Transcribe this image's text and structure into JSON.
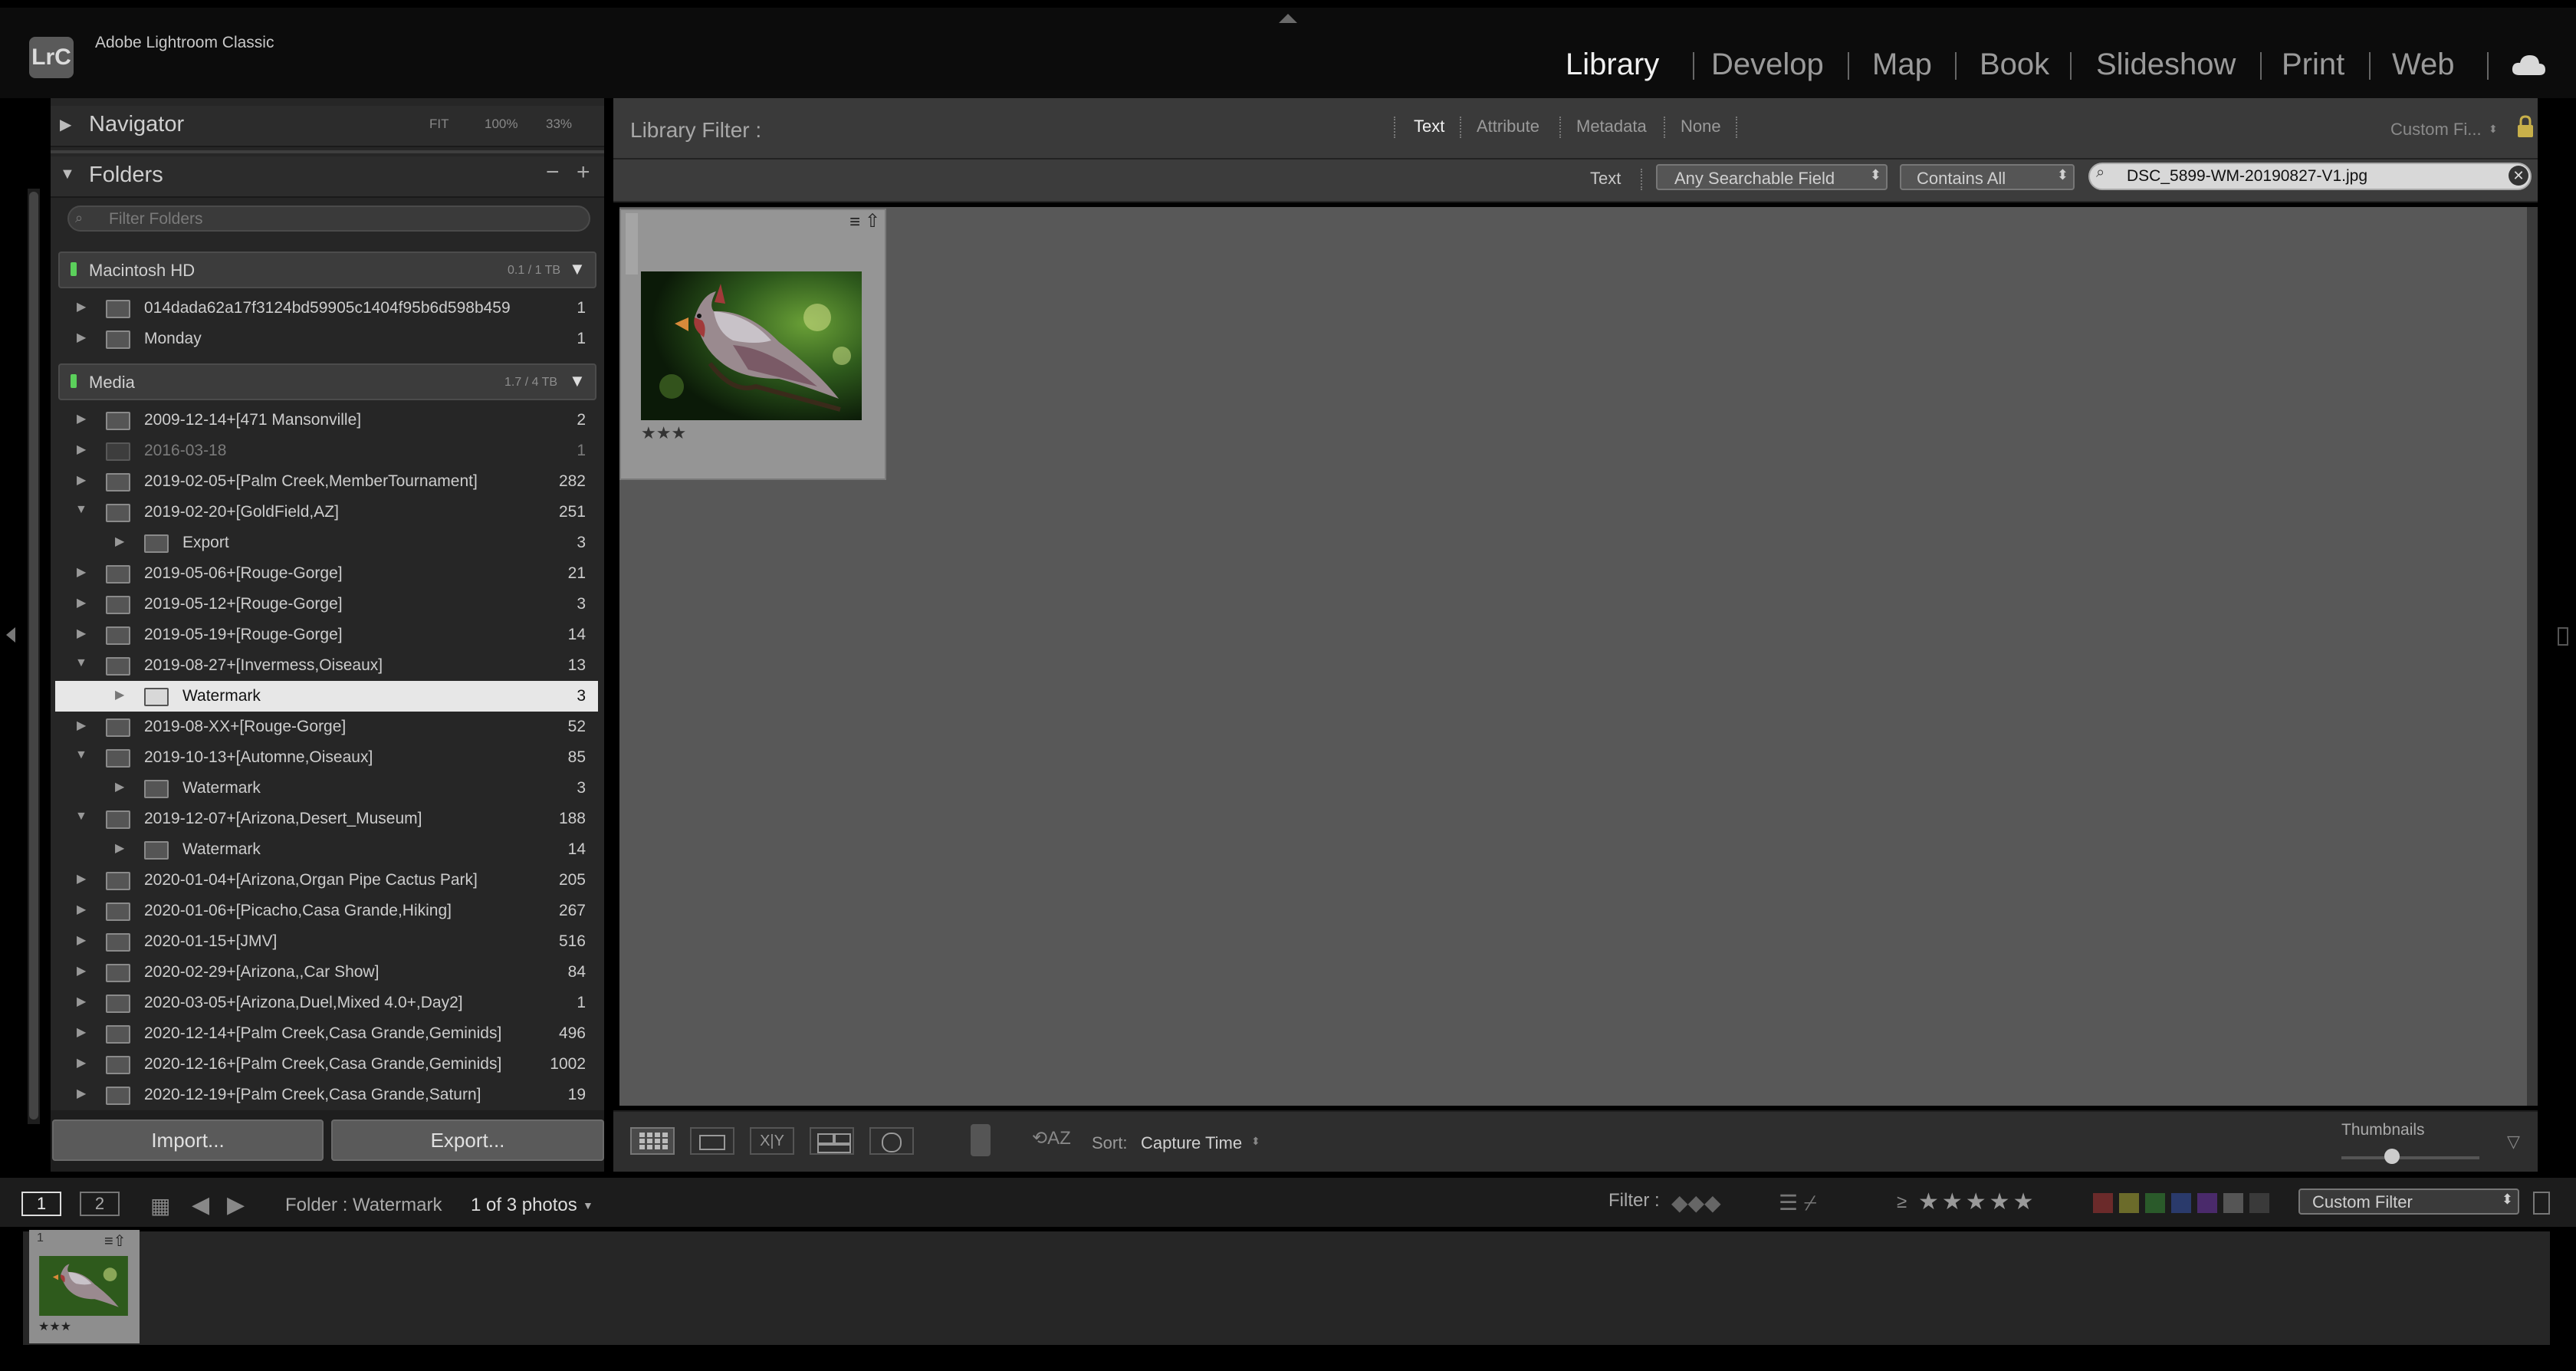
{
  "app": {
    "logo": "LrC",
    "name": "Adobe Lightroom Classic"
  },
  "modules": [
    {
      "label": "Library",
      "active": true
    },
    {
      "label": "Develop",
      "active": false
    },
    {
      "label": "Map",
      "active": false
    },
    {
      "label": "Book",
      "active": false
    },
    {
      "label": "Slideshow",
      "active": false
    },
    {
      "label": "Print",
      "active": false
    },
    {
      "label": "Web",
      "active": false
    }
  ],
  "navigator": {
    "title": "Navigator",
    "zoom_options": [
      "FIT",
      "100%",
      "33%"
    ]
  },
  "folders_panel": {
    "title": "Folders",
    "minus": "−",
    "plus": "+",
    "filter_placeholder": "Filter Folders",
    "volumes": [
      {
        "name": "Macintosh HD",
        "size": "0.1 / 1 TB"
      },
      {
        "name": "Media",
        "size": "1.7 / 4 TB"
      }
    ],
    "folders": [
      {
        "name": "014dada62a17f3124bd59905c1404f95b6d598b459",
        "count": "1",
        "level": 0,
        "expanded": false
      },
      {
        "name": "Monday",
        "count": "1",
        "level": 0,
        "expanded": false
      },
      {
        "name": "2009-12-14+[471 Mansonville]",
        "count": "2",
        "level": 0,
        "expanded": false
      },
      {
        "name": "2016-03-18",
        "count": "1",
        "level": 0,
        "expanded": false,
        "dim": true
      },
      {
        "name": "2019-02-05+[Palm Creek,MemberTournament]",
        "count": "282",
        "level": 0,
        "expanded": false
      },
      {
        "name": "2019-02-20+[GoldField,AZ]",
        "count": "251",
        "level": 0,
        "expanded": true
      },
      {
        "name": "Export",
        "count": "3",
        "level": 1,
        "expanded": false
      },
      {
        "name": "2019-05-06+[Rouge-Gorge]",
        "count": "21",
        "level": 0,
        "expanded": false
      },
      {
        "name": "2019-05-12+[Rouge-Gorge]",
        "count": "3",
        "level": 0,
        "expanded": false
      },
      {
        "name": "2019-05-19+[Rouge-Gorge]",
        "count": "14",
        "level": 0,
        "expanded": false
      },
      {
        "name": "2019-08-27+[Invermess,Oiseaux]",
        "count": "13",
        "level": 0,
        "expanded": true
      },
      {
        "name": "Watermark",
        "count": "3",
        "level": 1,
        "expanded": false,
        "selected": true
      },
      {
        "name": "2019-08-XX+[Rouge-Gorge]",
        "count": "52",
        "level": 0,
        "expanded": false
      },
      {
        "name": "2019-10-13+[Automne,Oiseaux]",
        "count": "85",
        "level": 0,
        "expanded": true
      },
      {
        "name": "Watermark",
        "count": "3",
        "level": 1,
        "expanded": false
      },
      {
        "name": "2019-12-07+[Arizona,Desert_Museum]",
        "count": "188",
        "level": 0,
        "expanded": true
      },
      {
        "name": "Watermark",
        "count": "14",
        "level": 1,
        "expanded": false
      },
      {
        "name": "2020-01-04+[Arizona,Organ Pipe Cactus Park]",
        "count": "205",
        "level": 0,
        "expanded": false
      },
      {
        "name": "2020-01-06+[Picacho,Casa Grande,Hiking]",
        "count": "267",
        "level": 0,
        "expanded": false
      },
      {
        "name": "2020-01-15+[JMV]",
        "count": "516",
        "level": 0,
        "expanded": false
      },
      {
        "name": "2020-02-29+[Arizona,,Car Show]",
        "count": "84",
        "level": 0,
        "expanded": false
      },
      {
        "name": "2020-03-05+[Arizona,Duel,Mixed 4.0+,Day2]",
        "count": "1",
        "level": 0,
        "expanded": false
      },
      {
        "name": "2020-12-14+[Palm Creek,Casa Grande,Geminids]",
        "count": "496",
        "level": 0,
        "expanded": false
      },
      {
        "name": "2020-12-16+[Palm Creek,Casa Grande,Geminids]",
        "count": "1002",
        "level": 0,
        "expanded": false
      },
      {
        "name": "2020-12-19+[Palm Creek,Casa Grande,Saturn]",
        "count": "19",
        "level": 0,
        "expanded": false
      }
    ]
  },
  "import_label": "Import...",
  "export_label": "Export...",
  "library_filter": {
    "title": "Library Filter :",
    "tabs": [
      "Text",
      "Attribute",
      "Metadata",
      "None"
    ],
    "active_tab": "Text",
    "preset": "Custom Fi...",
    "text_label": "Text",
    "field_select": "Any Searchable Field",
    "rule_select": "Contains All",
    "search_value": "DSC_5899-WM-20190827-V1.jpg"
  },
  "thumbnail": {
    "stars": "★★★"
  },
  "toolbar": {
    "sort_label": "Sort:",
    "sort_value": "Capture Time",
    "thumbnails_label": "Thumbnails"
  },
  "filmstrip_bar": {
    "page1": "1",
    "page2": "2",
    "folder_text": "Folder : Watermark",
    "photo_count": "1 of 3 photos",
    "filter_label": "Filter :",
    "rating_op": "≥",
    "filter_preset": "Custom Filter"
  },
  "filmstrip": {
    "index": "1",
    "stars": "★★★"
  },
  "colors": {
    "label_colors": [
      "#6b2a2a",
      "#6b6b2a",
      "#2a5a2a",
      "#2a3a6b",
      "#4a2a6b",
      "#555555",
      "#3a3a3a"
    ]
  }
}
